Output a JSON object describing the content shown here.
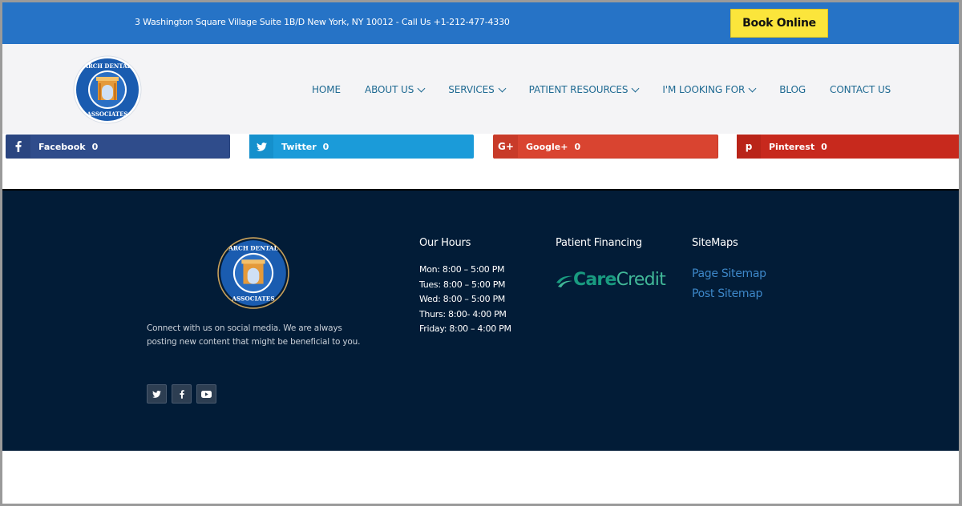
{
  "topbar": {
    "address": "3 Washington Square Village Suite 1B/D New York, NY 10012 - Call Us +1-212-477-4330",
    "book_label": "Book Online"
  },
  "header": {
    "logo_text": "ARCH DENTAL ASSOCIATES",
    "nav": [
      {
        "label": "HOME",
        "dropdown": false
      },
      {
        "label": "ABOUT US",
        "dropdown": true
      },
      {
        "label": "SERVICES",
        "dropdown": true
      },
      {
        "label": "PATIENT RESOURCES",
        "dropdown": true
      },
      {
        "label": "I'M LOOKING FOR",
        "dropdown": true
      },
      {
        "label": "BLOG",
        "dropdown": false
      },
      {
        "label": "CONTACT US",
        "dropdown": false
      }
    ]
  },
  "share": {
    "facebook": {
      "label": "Facebook",
      "count": "0",
      "icon": "facebook-icon"
    },
    "twitter": {
      "label": "Twitter",
      "count": "0",
      "icon": "twitter-icon"
    },
    "googleplus": {
      "label": "Google+",
      "count": "0",
      "icon": "google-plus-icon"
    },
    "pinterest": {
      "label": "Pinterest",
      "count": "0",
      "icon": "pinterest-icon"
    }
  },
  "footer": {
    "description": "Connect with us on social media.  We are always posting new content that might be beneficial to you.",
    "social_icons": [
      "twitter-icon",
      "facebook-icon",
      "youtube-icon"
    ],
    "hours_title": "Our Hours",
    "hours": [
      "Mon: 8:00 – 5:00 PM",
      "Tues: 8:00 – 5:00 PM",
      "Wed: 8:00 – 5:00 PM",
      "Thurs: 8:00- 4:00 PM",
      "Friday: 8:00 – 4:00 PM"
    ],
    "financing_title": "Patient Financing",
    "carecredit_care": "Care",
    "carecredit_credit": "Credit",
    "sitemaps_title": "SiteMaps",
    "sitemaps": [
      "Page Sitemap",
      "Post Sitemap"
    ]
  },
  "colors": {
    "topbar": "#2673c6",
    "book_button": "#fbe53b",
    "nav_link": "#1f6a92",
    "footer_bg": "#021c37",
    "facebook": "#2f4c8b",
    "twitter": "#1b9bd9",
    "googleplus": "#d94430",
    "pinterest": "#c7291d"
  }
}
